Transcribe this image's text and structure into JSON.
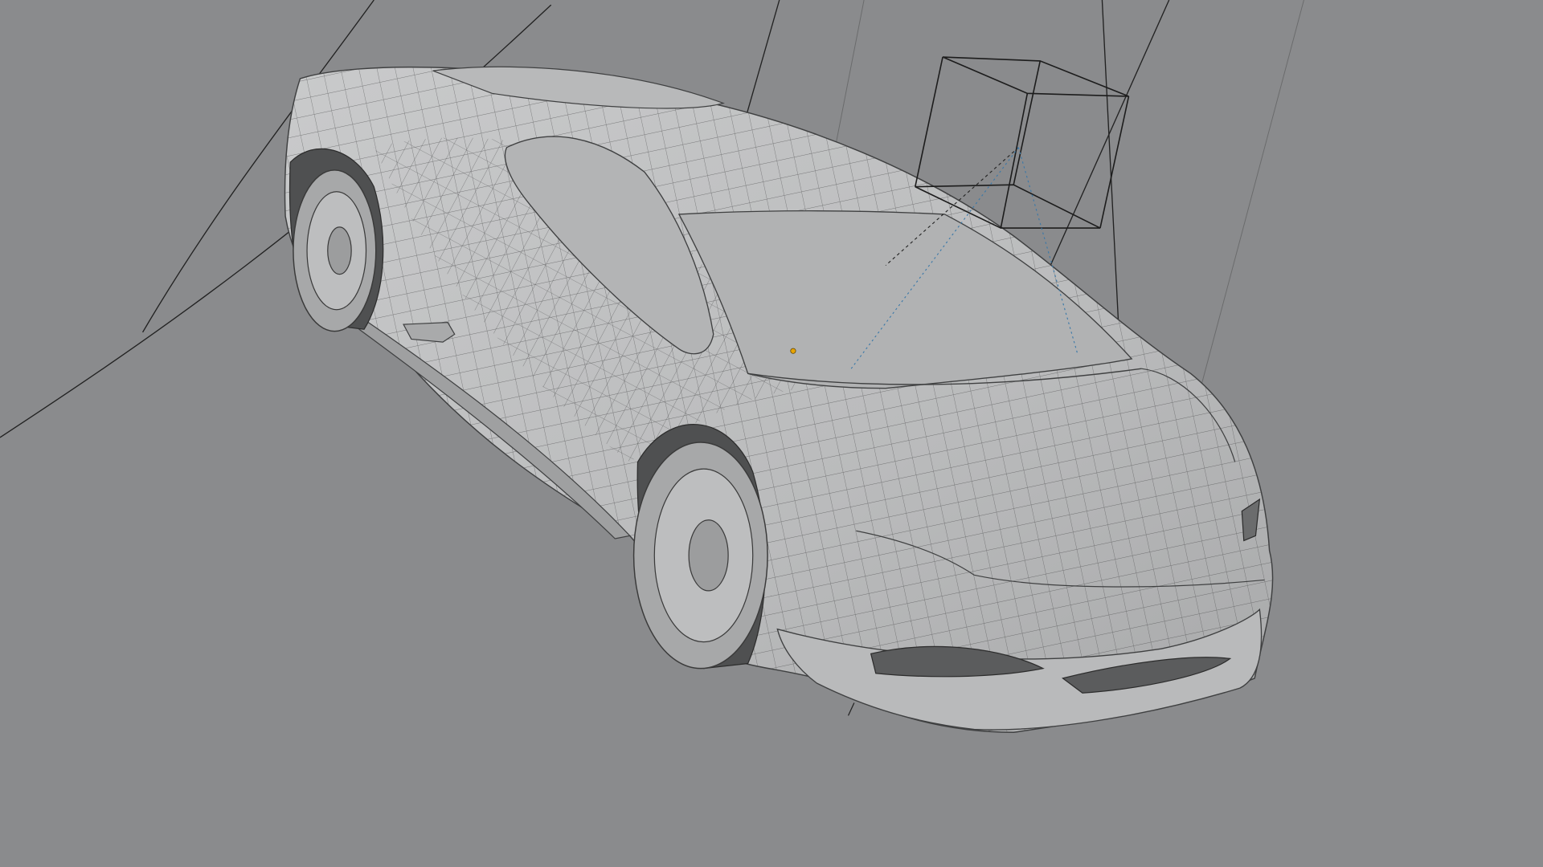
{
  "viewport": {
    "background_color": "#8a8b8d",
    "mode": "wireframe-overlay",
    "mesh": {
      "name_icon": "car-mesh-icon",
      "surface_color": "#bfc0c1",
      "wire_color": "#4a4b4c"
    },
    "objects": [
      {
        "type": "cube",
        "icon": "cube-empty-icon",
        "wire_color": "#1c1c1c"
      },
      {
        "type": "origin",
        "icon": "object-origin-icon",
        "color": "#e8a400"
      }
    ]
  }
}
